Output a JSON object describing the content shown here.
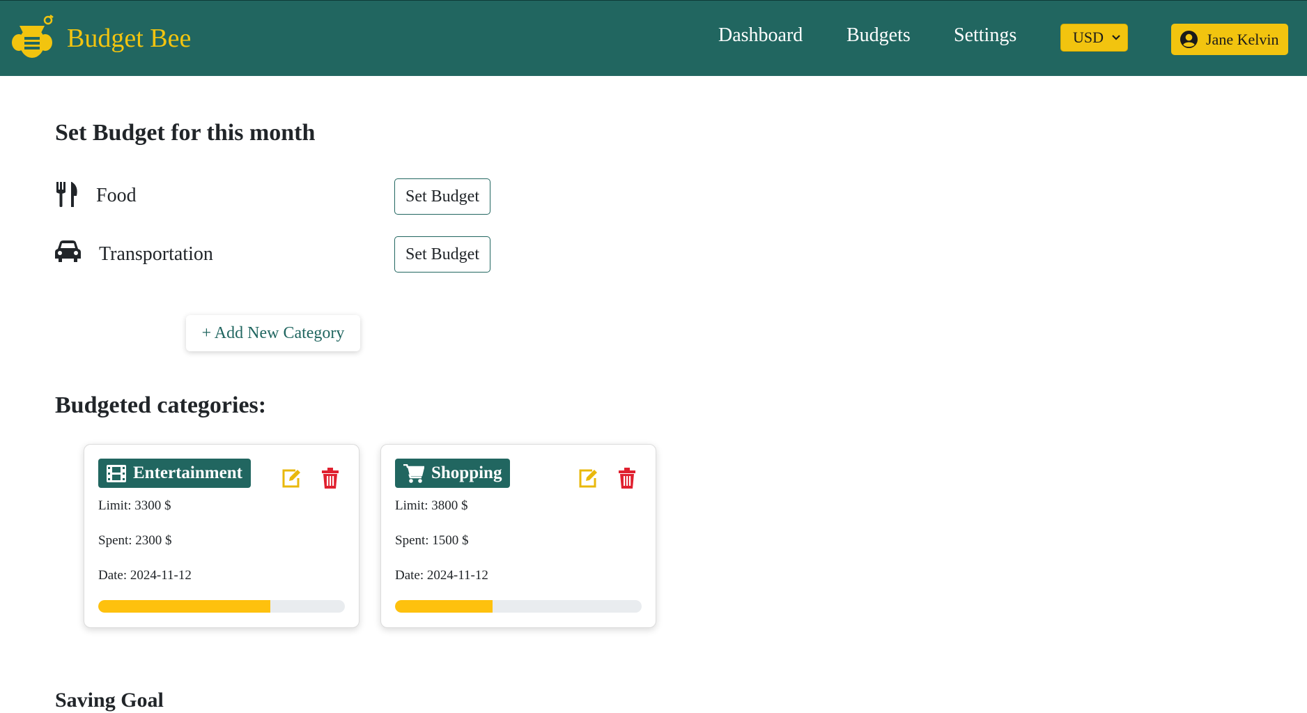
{
  "app": {
    "brand_name": "Budget Bee",
    "brand_color": "#f2c40f",
    "primary_color": "#216660"
  },
  "nav": {
    "links": [
      "Dashboard",
      "Budgets",
      "Settings"
    ],
    "currency": "USD",
    "user_name": "Jane Kelvin"
  },
  "set_budget": {
    "title": "Set Budget for this month",
    "categories": [
      {
        "label": "Food",
        "icon": "utensils-icon",
        "button": "Set Budget"
      },
      {
        "label": "Transportation",
        "icon": "car-icon",
        "button": "Set Budget"
      }
    ],
    "add_button": "+ Add New Category"
  },
  "budgeted": {
    "title": "Budgeted categories:",
    "cards": [
      {
        "name": "Entertainment",
        "icon": "film-icon",
        "limit": "Limit: 3300 $",
        "spent": "Spent: 2300 $",
        "date": "Date: 2024-11-12",
        "progress": 0.697
      },
      {
        "name": "Shopping",
        "icon": "cart-icon",
        "limit": "Limit: 3800 $",
        "spent": "Spent: 1500 $",
        "date": "Date: 2024-11-12",
        "progress": 0.395
      }
    ]
  },
  "saving": {
    "title": "Saving Goal"
  }
}
